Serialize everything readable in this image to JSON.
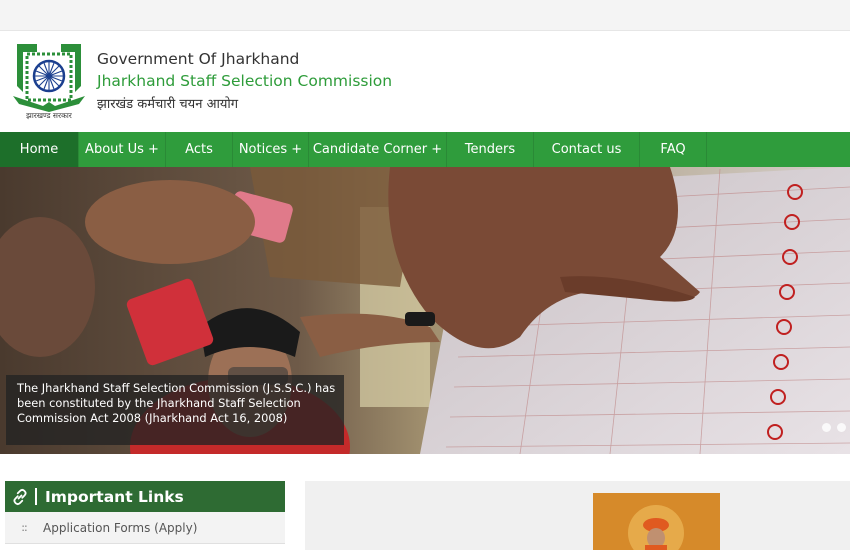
{
  "header": {
    "gov_title": "Government Of Jharkhand",
    "commission_title": "Jharkhand Staff Selection Commission",
    "hindi_title": "झारखंड कर्मचारी चयन आयोग",
    "logo_caption": "झारखण्ड सरकार"
  },
  "nav": {
    "items": [
      {
        "label": "Home"
      },
      {
        "label": "About Us +"
      },
      {
        "label": "Acts"
      },
      {
        "label": "Notices +"
      },
      {
        "label": "Candidate Corner +"
      },
      {
        "label": "Tenders"
      },
      {
        "label": "Contact us"
      },
      {
        "label": "FAQ"
      }
    ]
  },
  "hero": {
    "caption": "The Jharkhand Staff Selection Commission (J.S.S.C.) has been constituted by the Jharkhand Staff Selection Commission Act 2008 (Jharkhand Act 16, 2008)"
  },
  "links": {
    "title": "Important Links",
    "items": [
      {
        "label": "Application Forms (Apply)"
      }
    ]
  },
  "colors": {
    "nav_green": "#2f9c3c",
    "nav_active": "#1d6f2a",
    "commission_green": "#2e9c3a",
    "links_header": "#2e6b33"
  },
  "icons": {
    "logo": "emblem-logo",
    "links": "link-icon",
    "bullet": "grip-icon"
  }
}
